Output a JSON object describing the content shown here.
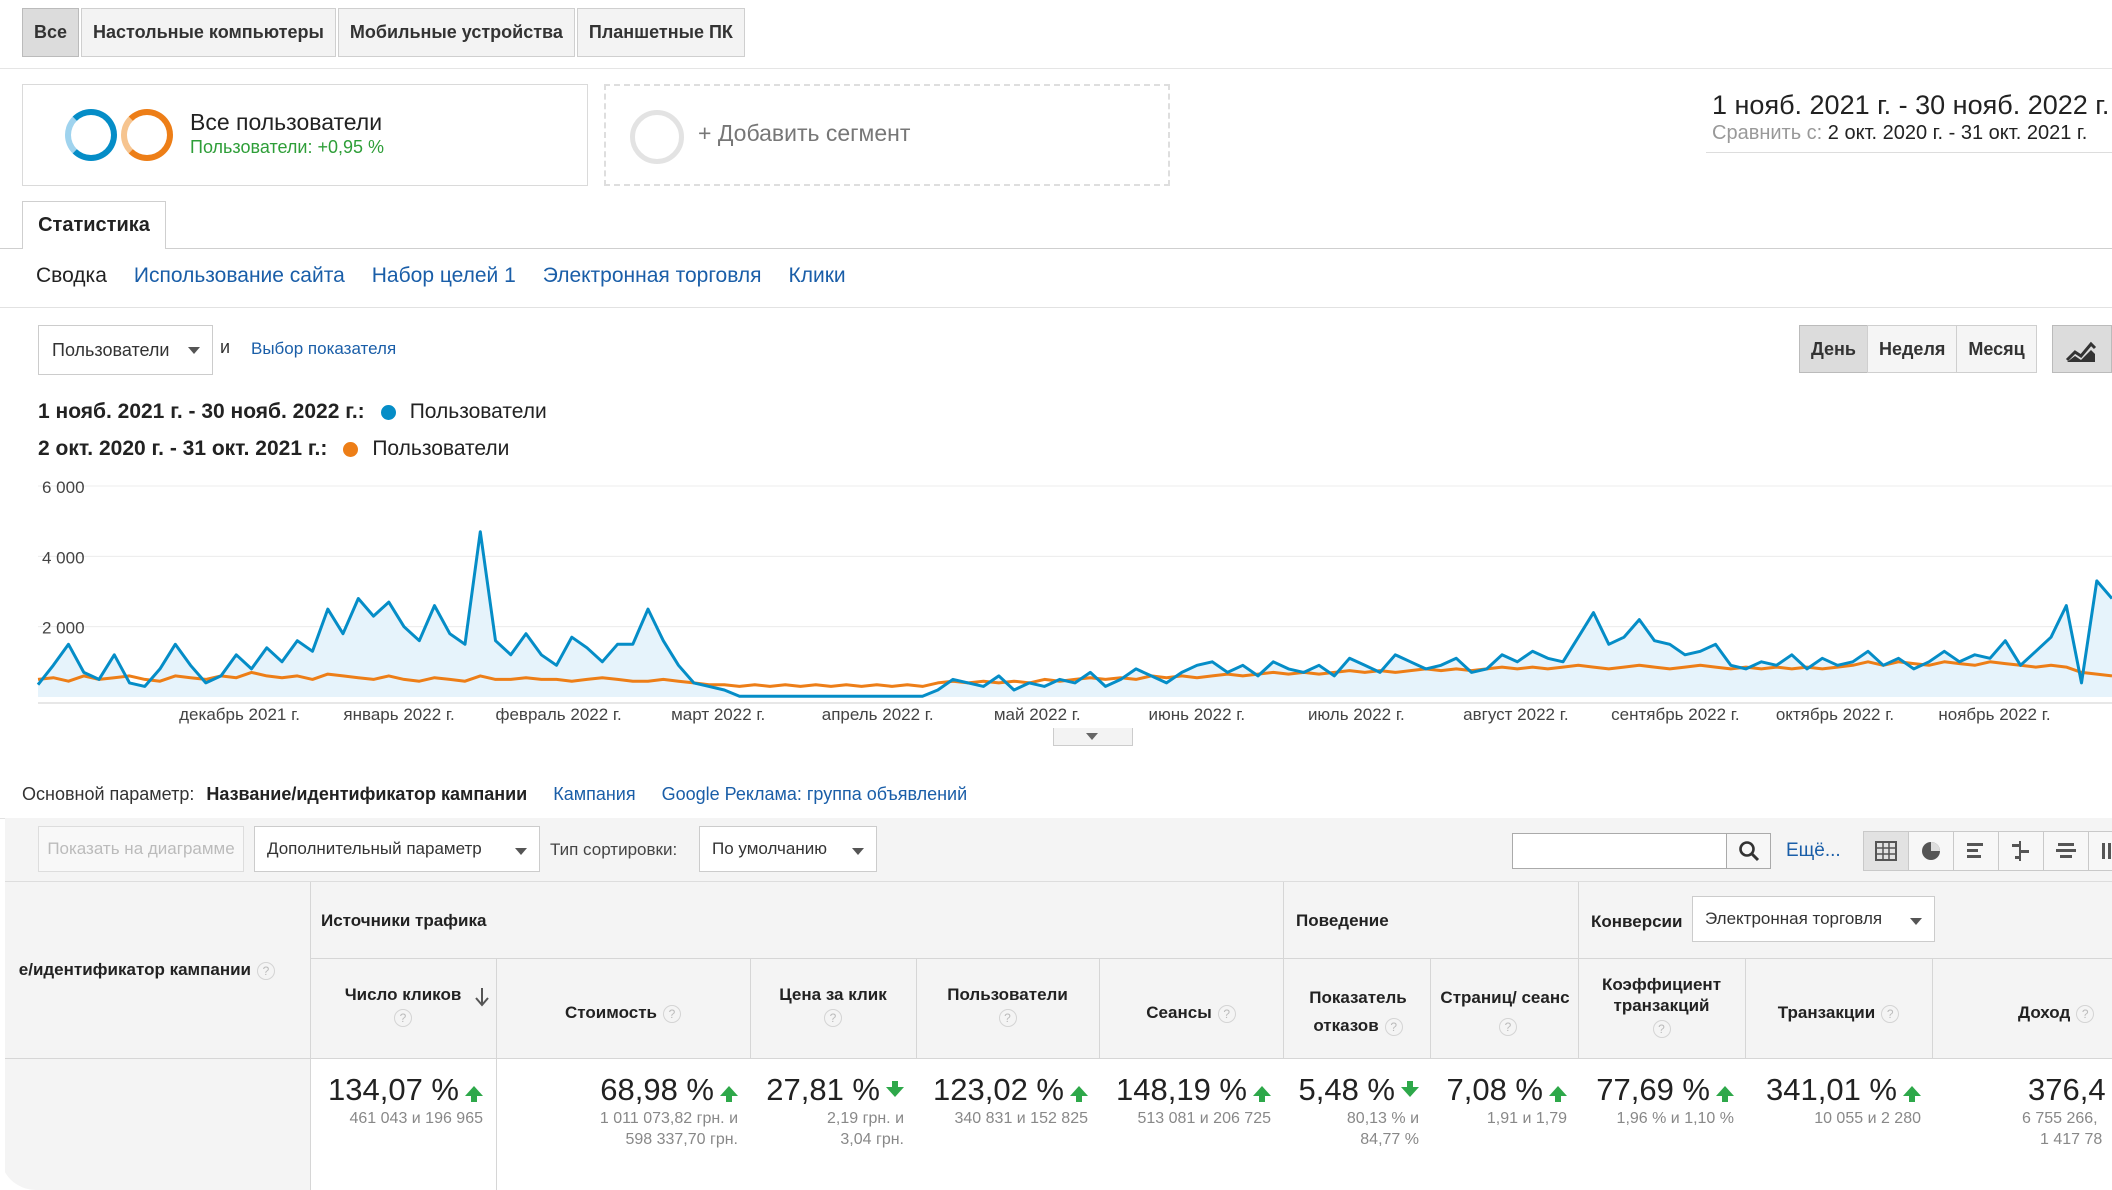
{
  "device_tabs": [
    "Все",
    "Настольные компьютеры",
    "Мобильные устройства",
    "Планшетные ПК"
  ],
  "segments": {
    "active": {
      "title": "Все пользователи",
      "subtitle": "Пользователи: +0,95 %"
    },
    "add_label": "+ Добавить сегмент"
  },
  "date_range": {
    "main": "1 нояб. 2021 г. - 30 нояб. 2022 г.",
    "compare_prefix": "Сравнить с:",
    "compare_value": "2 окт. 2020 г. - 31 окт. 2021 г."
  },
  "main_tab": "Статистика",
  "subnav": [
    "Сводка",
    "Использование сайта",
    "Набор целей 1",
    "Электронная торговля",
    "Клики"
  ],
  "metric_control": {
    "selected": "Пользователи",
    "and": "и",
    "pick_link": "Выбор показателя"
  },
  "period_buttons": [
    "День",
    "Неделя",
    "Месяц"
  ],
  "legend": [
    {
      "range": "1 нояб. 2021 г. - 30 нояб. 2022 г.:",
      "name": "Пользователи",
      "color": "#058dc7"
    },
    {
      "range": "2 окт. 2020 г. - 31 окт. 2021 г.:",
      "name": "Пользователи",
      "color": "#ed7e17"
    }
  ],
  "chart_data": {
    "type": "line",
    "y_ticks": [
      "6 000",
      "4 000",
      "2 000"
    ],
    "ylim": [
      0,
      6000
    ],
    "x_labels": [
      "декабрь 2021 г.",
      "январь 2022 г.",
      "февраль 2022 г.",
      "март 2022 г.",
      "апрель 2022 г.",
      "май 2022 г.",
      "июнь 2022 г.",
      "июль 2022 г.",
      "август 2022 г.",
      "сентябрь 2022 г.",
      "октябрь 2022 г.",
      "ноябрь 2022 г."
    ],
    "series": [
      {
        "name": "Пользователи",
        "color": "#058dc7",
        "values": [
          350,
          900,
          1500,
          700,
          500,
          1200,
          400,
          300,
          800,
          1500,
          900,
          400,
          600,
          1200,
          800,
          1400,
          1000,
          1600,
          1300,
          2500,
          1800,
          2800,
          2300,
          2700,
          2000,
          1600,
          2600,
          1800,
          1500,
          4700,
          1600,
          1200,
          1800,
          1200,
          900,
          1700,
          1400,
          1000,
          1500,
          1500,
          2500,
          1600,
          900,
          400,
          300,
          200,
          20,
          20,
          20,
          20,
          20,
          20,
          20,
          20,
          20,
          20,
          20,
          20,
          20,
          200,
          500,
          400,
          300,
          600,
          200,
          400,
          300,
          500,
          400,
          700,
          300,
          500,
          800,
          600,
          400,
          700,
          900,
          1000,
          700,
          900,
          600,
          1000,
          800,
          700,
          900,
          600,
          1100,
          900,
          700,
          1200,
          1000,
          800,
          900,
          1100,
          700,
          800,
          1200,
          1000,
          1300,
          1100,
          1000,
          1700,
          2400,
          1500,
          1700,
          2200,
          1600,
          1500,
          1200,
          1300,
          1500,
          900,
          800,
          1000,
          900,
          1200,
          800,
          1100,
          900,
          1000,
          1300,
          900,
          1100,
          800,
          1000,
          1300,
          1000,
          1200,
          1100,
          1600,
          900,
          1300,
          1700,
          2600,
          400,
          3300,
          2800
        ]
      },
      {
        "name": "Пользователи",
        "color": "#ed7e17",
        "values": [
          500,
          550,
          450,
          600,
          500,
          550,
          600,
          500,
          450,
          600,
          550,
          500,
          600,
          550,
          700,
          600,
          550,
          600,
          500,
          650,
          600,
          550,
          500,
          600,
          500,
          450,
          550,
          500,
          450,
          600,
          500,
          500,
          550,
          500,
          500,
          450,
          500,
          550,
          500,
          450,
          450,
          500,
          450,
          400,
          350,
          350,
          300,
          350,
          300,
          350,
          300,
          350,
          300,
          350,
          300,
          350,
          300,
          350,
          300,
          400,
          450,
          400,
          450,
          400,
          450,
          400,
          500,
          450,
          500,
          550,
          500,
          550,
          500,
          600,
          550,
          600,
          550,
          600,
          650,
          600,
          650,
          700,
          650,
          700,
          650,
          700,
          750,
          700,
          750,
          700,
          750,
          800,
          750,
          800,
          750,
          800,
          850,
          800,
          850,
          800,
          850,
          900,
          850,
          800,
          850,
          900,
          850,
          800,
          850,
          900,
          850,
          800,
          850,
          800,
          850,
          800,
          850,
          800,
          850,
          900,
          1000,
          900,
          1000,
          950,
          900,
          1000,
          950,
          900,
          1000,
          950,
          900,
          850,
          900,
          850,
          700,
          650,
          600
        ]
      }
    ]
  },
  "dimension_row": {
    "label": "Основной параметр:",
    "current": "Название/идентификатор кампании",
    "links": [
      "Кампания",
      "Google Реклама: группа объявлений"
    ]
  },
  "table_toolbar": {
    "show_chart": "Показать на диаграмме",
    "secondary_dim": "Дополнительный параметр",
    "sort_label": "Тип сортировки:",
    "sort_value": "По умолчанию",
    "more_link": "Ещё..."
  },
  "table": {
    "row_dim_header": "е/идентификатор кампании",
    "groups": {
      "traffic": "Источники трафика",
      "behavior": "Поведение",
      "conversions": "Конверсии",
      "conversion_select": "Электронная торговля"
    },
    "columns": [
      {
        "name": "Число кликов",
        "value": "134,07 %",
        "trend": "up",
        "detail": [
          "461 043 и 196 965"
        ]
      },
      {
        "name": "Стоимость",
        "value": "68,98 %",
        "trend": "up",
        "detail": [
          "1 011 073,82 грн. и",
          "598 337,70 грн."
        ]
      },
      {
        "name": "Цена за клик",
        "value": "27,81 %",
        "trend": "down",
        "detail": [
          "2,19 грн. и",
          "3,04 грн."
        ]
      },
      {
        "name": "Пользователи",
        "value": "123,02 %",
        "trend": "up",
        "detail": [
          "340 831 и 152 825"
        ]
      },
      {
        "name": "Сеансы",
        "value": "148,19 %",
        "trend": "up",
        "detail": [
          "513 081 и 206 725"
        ]
      },
      {
        "name": "Показатель отказов",
        "value": "5,48 %",
        "trend": "down",
        "detail": [
          "80,13 % и",
          "84,77 %"
        ]
      },
      {
        "name": "Страниц/ сеанс",
        "value": "7,08 %",
        "trend": "up",
        "detail": [
          "1,91 и 1,79"
        ]
      },
      {
        "name": "Коэффициент транзакций",
        "value": "77,69 %",
        "trend": "up",
        "detail": [
          "1,96 % и 1,10 %"
        ]
      },
      {
        "name": "Транзакции",
        "value": "341,01 %",
        "trend": "up",
        "detail": [
          "10 055 и 2 280"
        ]
      },
      {
        "name": "Доход",
        "value": "376,4",
        "trend": "",
        "detail": [
          "6 755 266,",
          "1 417 78"
        ]
      }
    ]
  }
}
